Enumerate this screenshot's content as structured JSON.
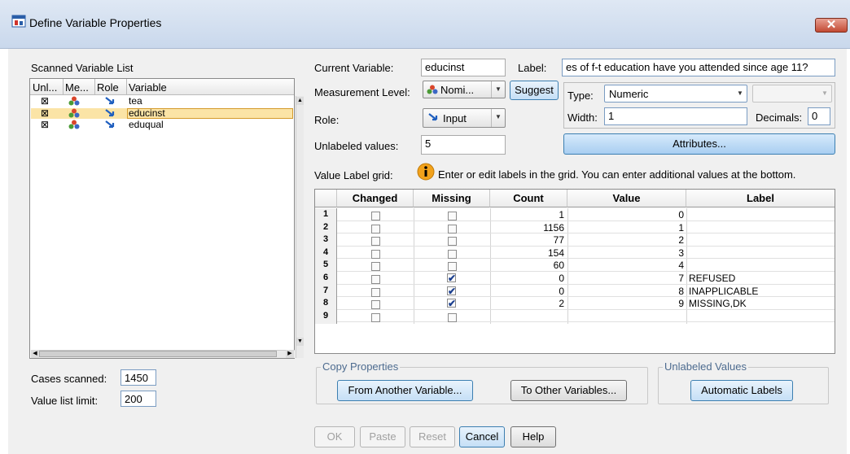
{
  "window": {
    "title": "Define Variable Properties",
    "close_glyph": "✕"
  },
  "scanned": {
    "title": "Scanned Variable List",
    "headers": [
      "Unl...",
      "Me...",
      "Role",
      "Variable"
    ],
    "rows": [
      {
        "unlabeled": "⊠",
        "variable": "tea"
      },
      {
        "unlabeled": "⊠",
        "variable": "educinst"
      },
      {
        "unlabeled": "⊠",
        "variable": "eduqual"
      }
    ],
    "cases_scanned_label": "Cases scanned:",
    "cases_scanned_value": "1450",
    "value_list_limit_label": "Value list limit:",
    "value_list_limit_value": "200"
  },
  "props": {
    "current_variable_label": "Current Variable:",
    "current_variable_value": "educinst",
    "label_label": "Label:",
    "label_value": "es of f-t education have you attended since age 11?",
    "measurement_label": "Measurement Level:",
    "measurement_value": "Nomi...",
    "suggest_label": "Suggest",
    "role_label": "Role:",
    "role_value": "Input",
    "unlabeled_label": "Unlabeled values:",
    "unlabeled_value": "5",
    "type_label": "Type:",
    "type_value": "Numeric",
    "width_label": "Width:",
    "width_value": "1",
    "decimals_label": "Decimals:",
    "decimals_value": "0",
    "attributes_label": "Attributes..."
  },
  "grid": {
    "label": "Value Label grid:",
    "info_text": "Enter or edit labels in the grid. You can enter additional values at the bottom.",
    "headers": [
      "Changed",
      "Missing",
      "Count",
      "Value",
      "Label"
    ],
    "rows": [
      {
        "n": "1",
        "missing": false,
        "count": "1",
        "value": "0",
        "label": ""
      },
      {
        "n": "2",
        "missing": false,
        "count": "1156",
        "value": "1",
        "label": ""
      },
      {
        "n": "3",
        "missing": false,
        "count": "77",
        "value": "2",
        "label": ""
      },
      {
        "n": "4",
        "missing": false,
        "count": "154",
        "value": "3",
        "label": ""
      },
      {
        "n": "5",
        "missing": false,
        "count": "60",
        "value": "4",
        "label": ""
      },
      {
        "n": "6",
        "missing": true,
        "count": "0",
        "value": "7",
        "label": "REFUSED"
      },
      {
        "n": "7",
        "missing": true,
        "count": "0",
        "value": "8",
        "label": "INAPPLICABLE"
      },
      {
        "n": "8",
        "missing": true,
        "count": "2",
        "value": "9",
        "label": "MISSING,DK"
      },
      {
        "n": "9",
        "missing": false,
        "count": "",
        "value": "",
        "label": ""
      }
    ]
  },
  "copy": {
    "title": "Copy Properties",
    "from_label": "From Another Variable...",
    "to_label": "To Other Variables...",
    "unlabeled_title": "Unlabeled Values",
    "auto_label": "Automatic Labels"
  },
  "buttons": {
    "ok": "OK",
    "paste": "Paste",
    "reset": "Reset",
    "cancel": "Cancel",
    "help": "Help"
  }
}
